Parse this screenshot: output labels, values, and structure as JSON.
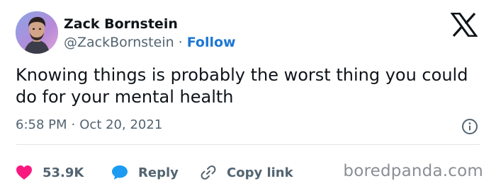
{
  "author": {
    "name": "Zack Bornstein",
    "handle": "@ZackBornstein",
    "separator": "·",
    "follow_label": "Follow"
  },
  "tweet": {
    "text": "Knowing things is probably the worst thing you could do for your mental health",
    "time": "6:58 PM",
    "separator": "·",
    "date": "Oct 20, 2021"
  },
  "actions": {
    "like_count": "53.9K",
    "reply_label": "Reply",
    "copy_link_label": "Copy link"
  },
  "watermark": "boredpanda.com",
  "icons": {
    "platform": "x-logo-icon",
    "info": "info-icon",
    "like": "heart-icon",
    "reply": "chat-bubble-icon",
    "copy": "link-icon"
  },
  "colors": {
    "like_accent": "#f91880",
    "reply_accent": "#1d9bf0",
    "follow_accent": "#1d77d4",
    "secondary_text": "#536471"
  }
}
